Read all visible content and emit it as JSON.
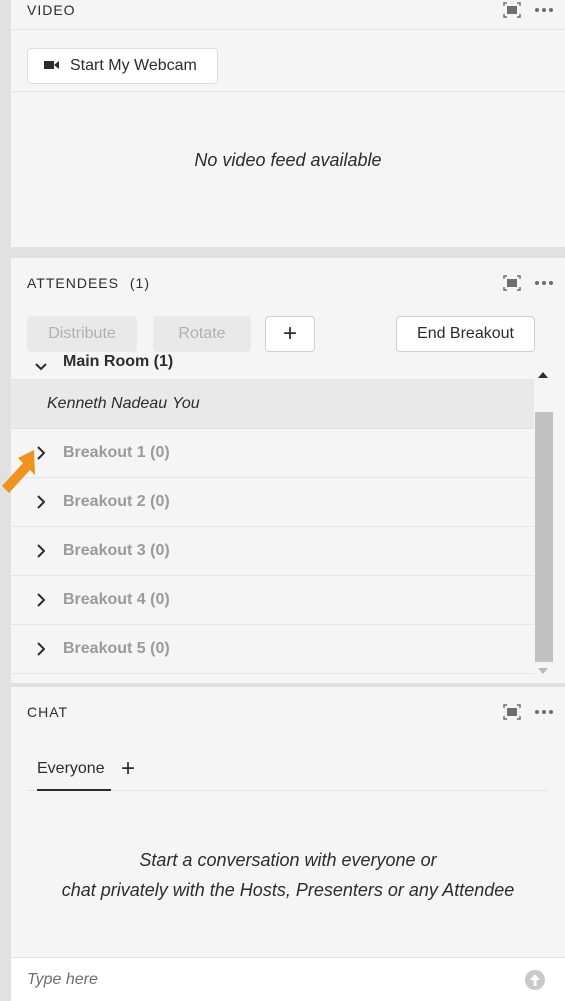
{
  "video": {
    "title": "VIDEO",
    "webcam_button": "Start My Webcam",
    "no_feed": "No video feed available"
  },
  "attendees": {
    "title": "ATTENDEES",
    "count": "(1)",
    "buttons": {
      "distribute": "Distribute",
      "rotate": "Rotate",
      "add": "+",
      "end_breakout": "End Breakout"
    },
    "main_room": "Main Room (1)",
    "attendee": {
      "name": "Kenneth Nadeau",
      "tag": "You"
    },
    "breakouts": [
      "Breakout 1 (0)",
      "Breakout 2 (0)",
      "Breakout 3 (0)",
      "Breakout 4 (0)",
      "Breakout 5 (0)"
    ]
  },
  "chat": {
    "title": "CHAT",
    "tab": "Everyone",
    "add": "+",
    "empty_line1": "Start a conversation with everyone or",
    "empty_line2": "chat privately with the Hosts, Presenters or any Attendee",
    "input_placeholder": "Type here"
  },
  "colors": {
    "cursor": "#f0921e",
    "panel_bg": "#f5f5f5",
    "page_bg": "#e1e1e1",
    "scroll_thumb": "#c1c1c1"
  }
}
